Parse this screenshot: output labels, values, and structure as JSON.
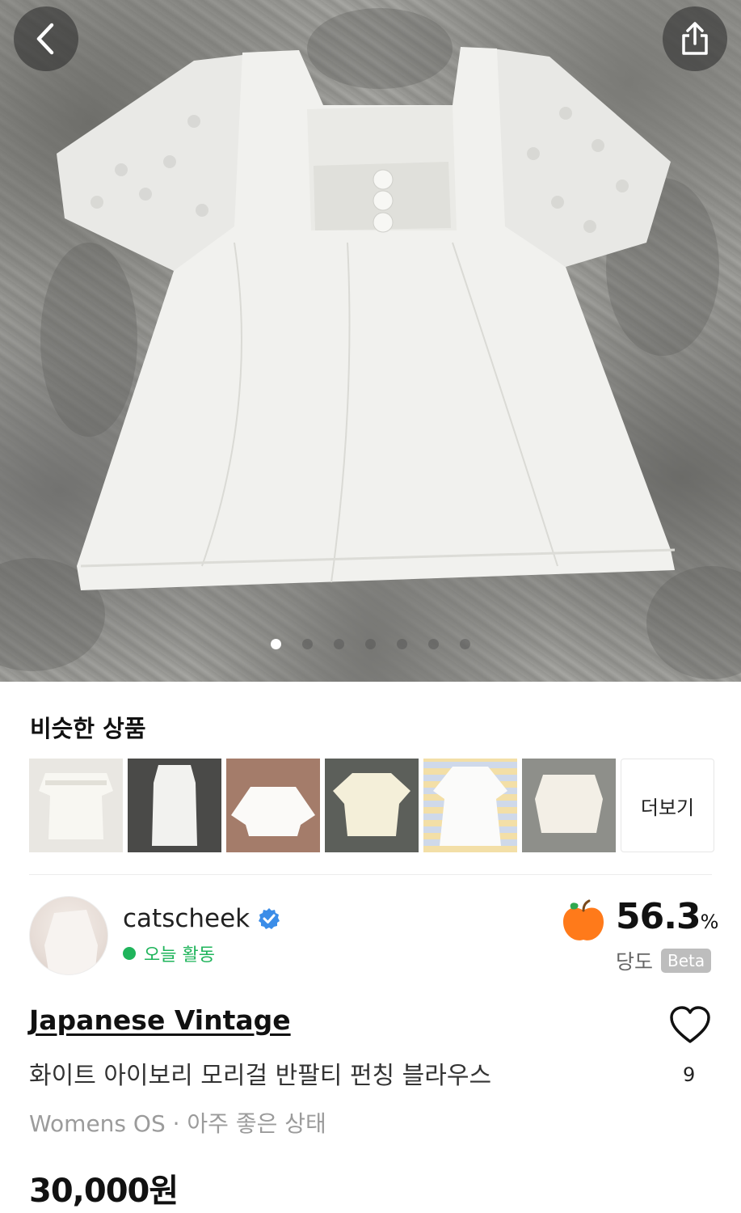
{
  "hero": {
    "back_icon": "chevron-left-icon",
    "share_icon": "share-icon",
    "image_count": 7,
    "active_index": 0
  },
  "similar": {
    "title": "비슷한 상품",
    "more_label": "더보기"
  },
  "seller": {
    "name": "catscheek",
    "verified_icon": "verified-badge-icon",
    "status": "오늘 활동",
    "status_color": "#1fb45b"
  },
  "sweetness": {
    "icon": "apple-icon",
    "value": "56.3",
    "unit": "%",
    "label": "당도",
    "badge": "Beta"
  },
  "product": {
    "brand": "Japanese Vintage",
    "title": "화이트 아이보리 모리걸 반팔티 펀칭 블라우스",
    "meta": "Womens OS · 아주 좋은 상태",
    "price": "30,000원",
    "like_count": "9"
  }
}
